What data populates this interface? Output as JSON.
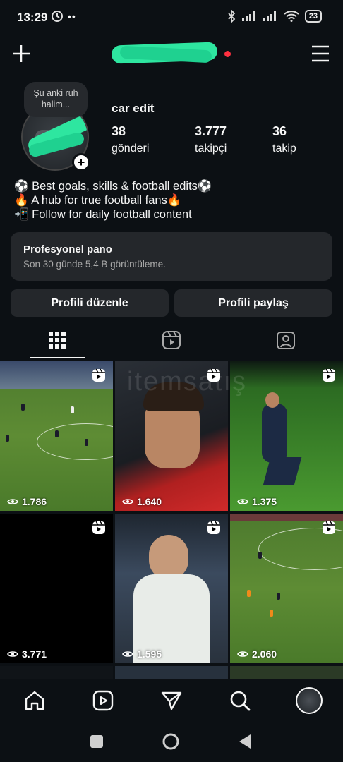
{
  "status_bar": {
    "time": "13:29",
    "battery": "23"
  },
  "profile": {
    "note": "Şu anki ruh halim...",
    "display_name": "car edit",
    "stats": [
      {
        "value": "38",
        "label": "gönderi"
      },
      {
        "value": "3.777",
        "label": "takipçi"
      },
      {
        "value": "36",
        "label": "takip"
      }
    ],
    "bio": [
      "⚽ Best goals, skills & football edits⚽",
      "🔥 A hub for true football fans🔥",
      "📲 Follow for daily football content"
    ]
  },
  "pro_panel": {
    "title": "Profesyonel pano",
    "subtitle": "Son 30 günde 5,4 B görüntüleme."
  },
  "actions": {
    "edit_label": "Profili düzenle",
    "share_label": "Profili paylaş"
  },
  "tabs": [
    "grid-icon",
    "reels-icon",
    "tagged-icon"
  ],
  "posts": [
    {
      "views": "1.786",
      "type": "reel"
    },
    {
      "views": "1.640",
      "type": "reel"
    },
    {
      "views": "1.375",
      "type": "reel"
    },
    {
      "views": "3.771",
      "type": "reel"
    },
    {
      "views": "1.595",
      "type": "reel"
    },
    {
      "views": "2.060",
      "type": "reel"
    }
  ],
  "watermark": "itemsatış",
  "colors": {
    "background": "#0c1014",
    "panel": "#24272b",
    "notification": "#ff3040",
    "redaction": "#2ee6a0"
  }
}
